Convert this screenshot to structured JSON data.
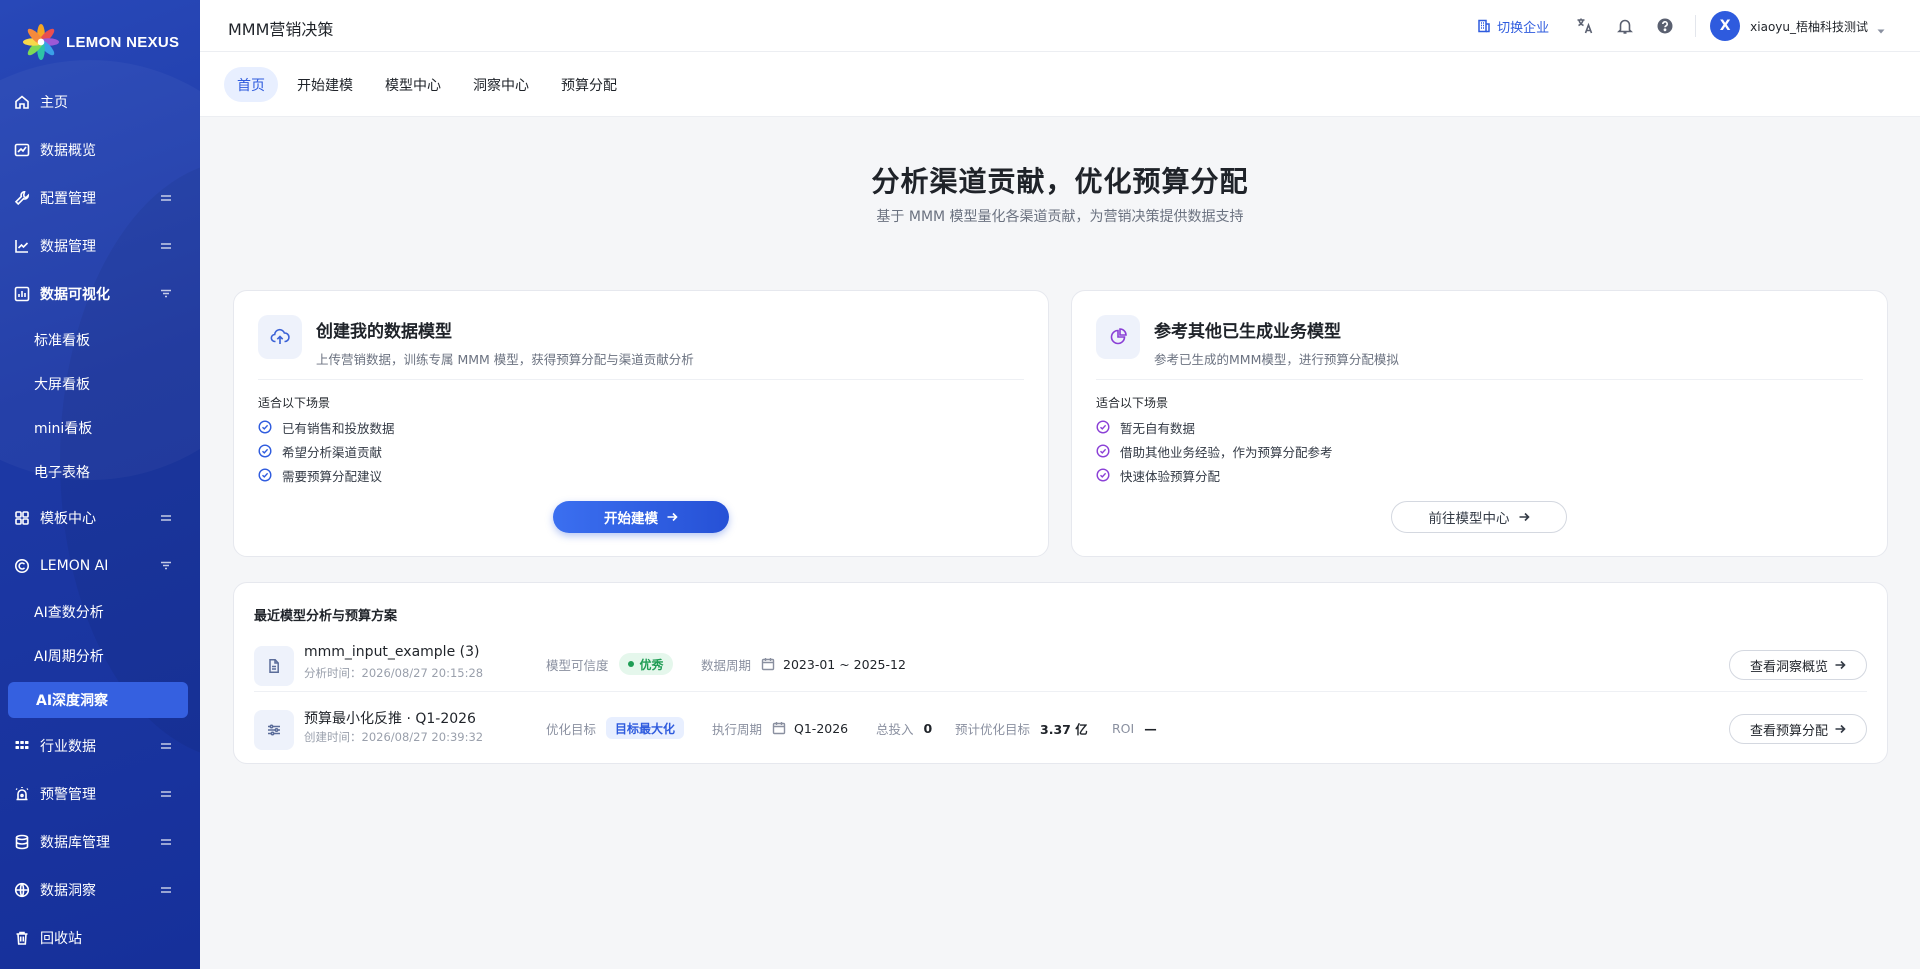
{
  "brand": {
    "name": "LEMON NEXUS"
  },
  "sidebar": {
    "items": [
      {
        "label": "主页",
        "icon": "home-icon"
      },
      {
        "label": "数据概览",
        "icon": "chart-line-icon"
      },
      {
        "label": "配置管理",
        "icon": "wrench-icon"
      },
      {
        "label": "数据管理",
        "icon": "trend-icon"
      },
      {
        "label": "数据可视化",
        "icon": "bar-chart-icon"
      },
      {
        "label": "模板中心",
        "icon": "grid-icon"
      },
      {
        "label": "LEMON AI",
        "icon": "ai-icon"
      },
      {
        "label": "行业数据",
        "icon": "apps-icon"
      },
      {
        "label": "预警管理",
        "icon": "alarm-icon"
      },
      {
        "label": "数据库管理",
        "icon": "database-icon"
      },
      {
        "label": "数据洞察",
        "icon": "globe-icon"
      },
      {
        "label": "回收站",
        "icon": "trash-icon"
      }
    ],
    "viz_sub": [
      "标准看板",
      "大屏看板",
      "mini看板",
      "电子表格"
    ],
    "ai_sub": [
      "AI查数分析",
      "AI周期分析",
      "AI深度洞察"
    ]
  },
  "header": {
    "title": "MMM营销决策",
    "switch_label": "切换企业",
    "user_initial": "X",
    "user_name": "xiaoyu_梧柚科技测试"
  },
  "tabs": [
    "首页",
    "开始建模",
    "模型中心",
    "洞察中心",
    "预算分配"
  ],
  "hero": {
    "title": "分析渠道贡献，优化预算分配",
    "subtitle": "基于 MMM 模型量化各渠道贡献，为营销决策提供数据支持"
  },
  "card_create": {
    "title": "创建我的数据模型",
    "desc": "上传营销数据，训练专属 MMM 模型，获得预算分配与渠道贡献分析",
    "scene_label": "适合以下场景",
    "scenes": [
      "已有销售和投放数据",
      "希望分析渠道贡献",
      "需要预算分配建议"
    ],
    "button": "开始建模"
  },
  "card_ref": {
    "title": "参考其他已生成业务模型",
    "desc": "参考已生成的MMM模型，进行预算分配模拟",
    "scene_label": "适合以下场景",
    "scenes": [
      "暂无自有数据",
      "借助其他业务经验，作为预算分配参考",
      "快速体验预算分配"
    ],
    "button": "前往模型中心"
  },
  "recent": {
    "title": "最近模型分析与预算方案",
    "row1": {
      "name": "mmm_input_example (3)",
      "time": "分析时间：2026/08/27 20:15:28",
      "credibility_label": "模型可信度",
      "credibility_value": "优秀",
      "period_label": "数据周期",
      "period_value": "2023-01 ~ 2025-12",
      "button": "查看洞察概览"
    },
    "row2": {
      "name": "预算最小化反推 · Q1-2026",
      "time": "创建时间：2026/08/27 20:39:32",
      "target_label": "优化目标",
      "target_value": "目标最大化",
      "exec_label": "执行周期",
      "exec_value": "Q1-2026",
      "invest_label": "总投入",
      "invest_value": "0",
      "forecast_label": "预计优化目标",
      "forecast_value": "3.37 亿",
      "roi_label": "ROI",
      "roi_value": "—",
      "button": "查看预算分配"
    }
  },
  "colors": {
    "primary": "#2e5bde",
    "sidebar": "#1d39a5",
    "success": "#1f9d55"
  }
}
